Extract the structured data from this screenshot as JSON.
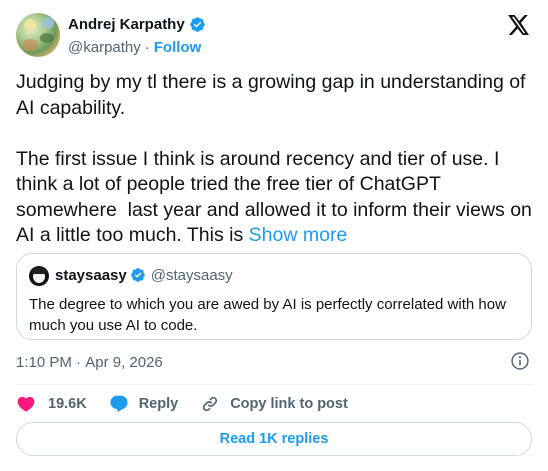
{
  "author": {
    "display_name": "Andrej Karpathy",
    "handle": "@karpathy",
    "separator": "·",
    "follow_label": "Follow",
    "verified_icon": "verified-badge-icon"
  },
  "brand_icon": "x-logo-icon",
  "tweet": {
    "paragraph1": "Judging by my tl there is a growing gap in understanding of AI capability.",
    "paragraph2": "The first issue I think is around recency and tier of use. I think a lot of people tried the free tier of ChatGPT somewhere  last year and allowed it to inform their views on AI a little too much. This is ",
    "show_more_label": "Show more"
  },
  "quote": {
    "display_name": "staysaasy",
    "handle": "@staysaasy",
    "text": "The degree to which you are awed by AI is perfectly correlated with how much you use AI to code."
  },
  "meta": {
    "time": "1:10 PM",
    "separator": " · ",
    "date": "Apr 9, 2026"
  },
  "actions": {
    "likes": "19.6K",
    "reply_label": "Reply",
    "copy_link_label": "Copy link to post"
  },
  "read_replies_label": "Read 1K replies",
  "colors": {
    "accent": "#1d9bf0",
    "like": "#f91880",
    "text": "#0f1419",
    "muted": "#536471",
    "border": "#cfd9de"
  }
}
